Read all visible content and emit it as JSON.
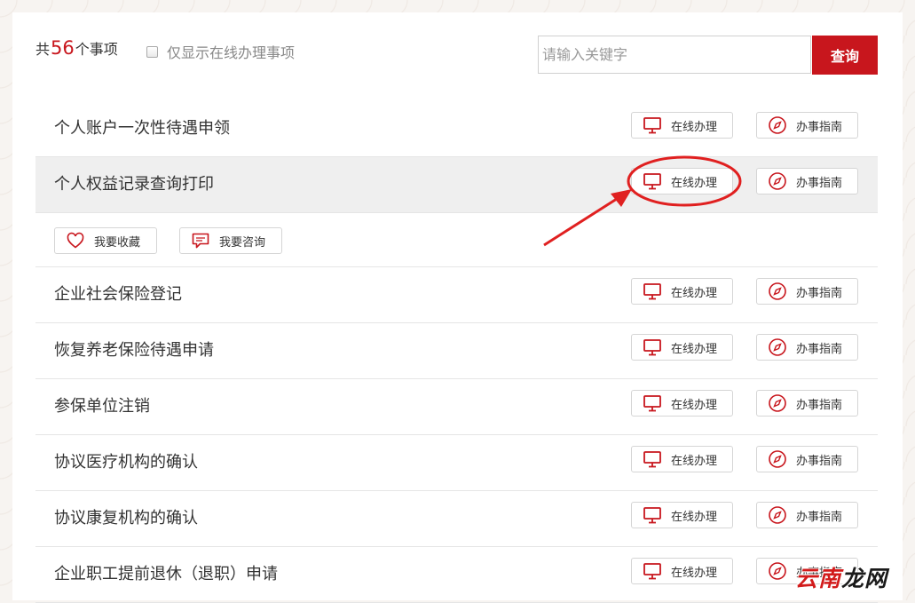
{
  "summary": {
    "prefix": "共",
    "count": "56",
    "suffix": "个事项"
  },
  "filter": {
    "only_online_label": "仅显示在线办理事项",
    "checked": false
  },
  "search": {
    "placeholder": "请输入关键字",
    "value": "",
    "button_label": "查询"
  },
  "buttons": {
    "online": "在线办理",
    "guide": "办事指南",
    "favorite": "我要收藏",
    "consult": "我要咨询"
  },
  "items": [
    {
      "title": "个人账户一次性待遇申领"
    },
    {
      "title": "个人权益记录查询打印"
    },
    {
      "title": "企业社会保险登记"
    },
    {
      "title": "恢复养老保险待遇申请"
    },
    {
      "title": "参保单位注销"
    },
    {
      "title": "协议医疗机构的确认"
    },
    {
      "title": "协议康复机构的确认"
    },
    {
      "title": "企业职工提前退休（退职）申请"
    }
  ],
  "watermark": {
    "part1": "云南",
    "part2": "龙网"
  },
  "colors": {
    "accent": "#c8161d",
    "annotation": "#e02020"
  },
  "icons": {
    "online": "monitor-icon",
    "guide": "compass-icon",
    "favorite": "heart-icon",
    "consult": "chat-bubble-icon"
  }
}
